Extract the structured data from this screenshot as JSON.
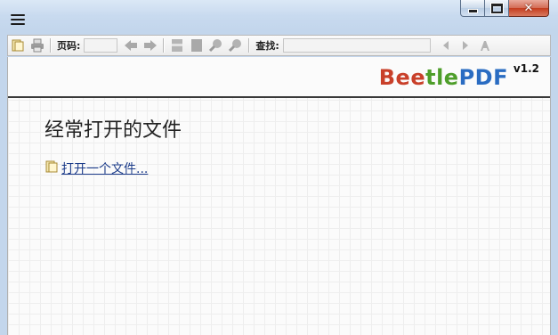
{
  "toolbar": {
    "page_label": "页码:",
    "page_value": "",
    "search_label": "查找:",
    "search_value": ""
  },
  "brand": {
    "part1": "Bee",
    "part2": "tle",
    "part3": "PDF",
    "version": "v1.2"
  },
  "main": {
    "heading": "经常打开的文件",
    "open_file_link": "打开一个文件..."
  },
  "icons": {
    "menu": "hamburger-menu-icon",
    "open": "open-file-icon",
    "print": "print-icon",
    "prev_page": "left-arrow-icon",
    "next_page": "right-arrow-icon",
    "fit_width": "fit-width-icon",
    "fit_page": "fit-page-icon",
    "zoom_in": "zoom-in-icon",
    "zoom_out": "zoom-out-icon",
    "find_prev": "find-prev-icon",
    "find_next": "find-next-icon",
    "case": "match-case-icon"
  },
  "colors": {
    "brand_red": "#c9402a",
    "brand_green": "#4e9e2a",
    "brand_blue": "#2a6cc2",
    "link": "#1c3c8a"
  }
}
